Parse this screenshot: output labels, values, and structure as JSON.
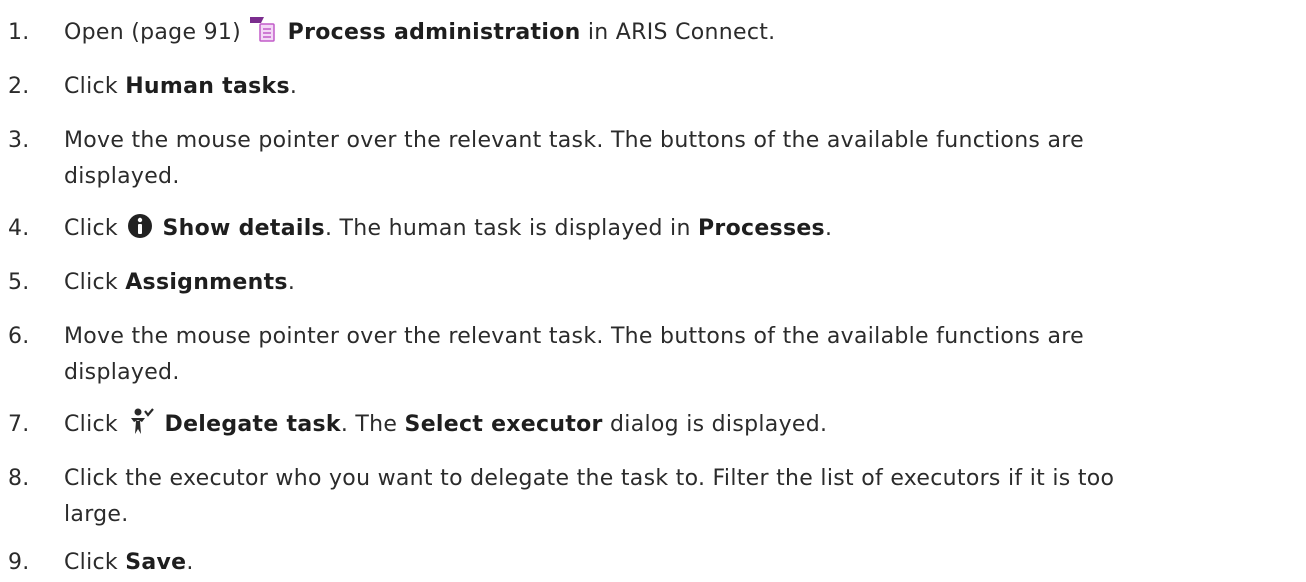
{
  "steps": [
    {
      "num": "1.",
      "parts": [
        "Open (page 91) ",
        "Process administration",
        " in ARIS Connect."
      ],
      "icon": "process-administration-icon"
    },
    {
      "num": "2.",
      "parts": [
        "Click ",
        "Human tasks",
        "."
      ]
    },
    {
      "num": "3.",
      "text": "Move the mouse pointer over the relevant task. The buttons of the available functions are",
      "text2": "displayed."
    },
    {
      "num": "4.",
      "parts": [
        "Click ",
        "Show details",
        ". The human task is displayed in ",
        "Processes",
        "."
      ],
      "icon": "info-icon"
    },
    {
      "num": "5.",
      "parts": [
        "Click ",
        "Assignments",
        "."
      ]
    },
    {
      "num": "6.",
      "text": "Move the mouse pointer over the relevant task. The buttons of the available functions are",
      "text2": "displayed."
    },
    {
      "num": "7.",
      "parts": [
        "Click ",
        "Delegate task",
        ". The ",
        "Select executor",
        " dialog is displayed."
      ],
      "icon": "delegate-task-icon"
    },
    {
      "num": "8.",
      "text": "Click the executor who you want to delegate the task to. Filter the list of executors if it is too",
      "text2": "large."
    },
    {
      "num": "9.",
      "parts": [
        "Click ",
        "Save",
        "."
      ]
    }
  ],
  "colors": {
    "text": "#2b2b2b",
    "process_icon_purple": "#7b2d8e",
    "process_icon_page": "#c25bc9",
    "info_icon": "#222222",
    "delegate_icon": "#2a2a2a"
  }
}
